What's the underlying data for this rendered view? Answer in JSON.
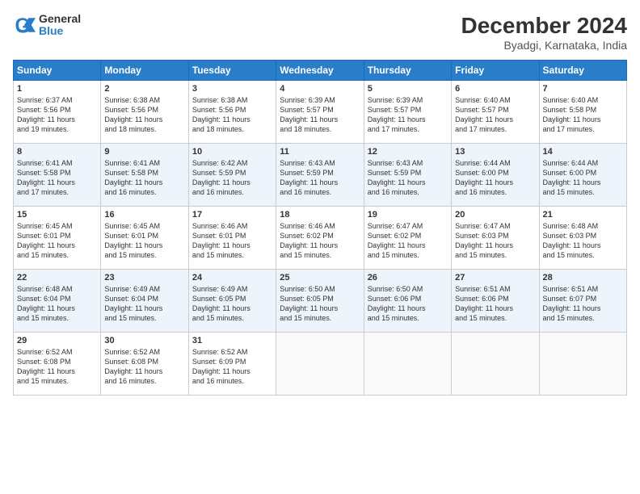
{
  "header": {
    "logo_general": "General",
    "logo_blue": "Blue",
    "month_title": "December 2024",
    "location": "Byadgi, Karnataka, India"
  },
  "days_of_week": [
    "Sunday",
    "Monday",
    "Tuesday",
    "Wednesday",
    "Thursday",
    "Friday",
    "Saturday"
  ],
  "weeks": [
    [
      {
        "day": "1",
        "sunrise": "6:37 AM",
        "sunset": "5:56 PM",
        "daylight": "11 hours and 19 minutes."
      },
      {
        "day": "2",
        "sunrise": "6:38 AM",
        "sunset": "5:56 PM",
        "daylight": "11 hours and 18 minutes."
      },
      {
        "day": "3",
        "sunrise": "6:38 AM",
        "sunset": "5:56 PM",
        "daylight": "11 hours and 18 minutes."
      },
      {
        "day": "4",
        "sunrise": "6:39 AM",
        "sunset": "5:57 PM",
        "daylight": "11 hours and 18 minutes."
      },
      {
        "day": "5",
        "sunrise": "6:39 AM",
        "sunset": "5:57 PM",
        "daylight": "11 hours and 17 minutes."
      },
      {
        "day": "6",
        "sunrise": "6:40 AM",
        "sunset": "5:57 PM",
        "daylight": "11 hours and 17 minutes."
      },
      {
        "day": "7",
        "sunrise": "6:40 AM",
        "sunset": "5:58 PM",
        "daylight": "11 hours and 17 minutes."
      }
    ],
    [
      {
        "day": "8",
        "sunrise": "6:41 AM",
        "sunset": "5:58 PM",
        "daylight": "11 hours and 17 minutes."
      },
      {
        "day": "9",
        "sunrise": "6:41 AM",
        "sunset": "5:58 PM",
        "daylight": "11 hours and 16 minutes."
      },
      {
        "day": "10",
        "sunrise": "6:42 AM",
        "sunset": "5:59 PM",
        "daylight": "11 hours and 16 minutes."
      },
      {
        "day": "11",
        "sunrise": "6:43 AM",
        "sunset": "5:59 PM",
        "daylight": "11 hours and 16 minutes."
      },
      {
        "day": "12",
        "sunrise": "6:43 AM",
        "sunset": "5:59 PM",
        "daylight": "11 hours and 16 minutes."
      },
      {
        "day": "13",
        "sunrise": "6:44 AM",
        "sunset": "6:00 PM",
        "daylight": "11 hours and 16 minutes."
      },
      {
        "day": "14",
        "sunrise": "6:44 AM",
        "sunset": "6:00 PM",
        "daylight": "11 hours and 15 minutes."
      }
    ],
    [
      {
        "day": "15",
        "sunrise": "6:45 AM",
        "sunset": "6:01 PM",
        "daylight": "11 hours and 15 minutes."
      },
      {
        "day": "16",
        "sunrise": "6:45 AM",
        "sunset": "6:01 PM",
        "daylight": "11 hours and 15 minutes."
      },
      {
        "day": "17",
        "sunrise": "6:46 AM",
        "sunset": "6:01 PM",
        "daylight": "11 hours and 15 minutes."
      },
      {
        "day": "18",
        "sunrise": "6:46 AM",
        "sunset": "6:02 PM",
        "daylight": "11 hours and 15 minutes."
      },
      {
        "day": "19",
        "sunrise": "6:47 AM",
        "sunset": "6:02 PM",
        "daylight": "11 hours and 15 minutes."
      },
      {
        "day": "20",
        "sunrise": "6:47 AM",
        "sunset": "6:03 PM",
        "daylight": "11 hours and 15 minutes."
      },
      {
        "day": "21",
        "sunrise": "6:48 AM",
        "sunset": "6:03 PM",
        "daylight": "11 hours and 15 minutes."
      }
    ],
    [
      {
        "day": "22",
        "sunrise": "6:48 AM",
        "sunset": "6:04 PM",
        "daylight": "11 hours and 15 minutes."
      },
      {
        "day": "23",
        "sunrise": "6:49 AM",
        "sunset": "6:04 PM",
        "daylight": "11 hours and 15 minutes."
      },
      {
        "day": "24",
        "sunrise": "6:49 AM",
        "sunset": "6:05 PM",
        "daylight": "11 hours and 15 minutes."
      },
      {
        "day": "25",
        "sunrise": "6:50 AM",
        "sunset": "6:05 PM",
        "daylight": "11 hours and 15 minutes."
      },
      {
        "day": "26",
        "sunrise": "6:50 AM",
        "sunset": "6:06 PM",
        "daylight": "11 hours and 15 minutes."
      },
      {
        "day": "27",
        "sunrise": "6:51 AM",
        "sunset": "6:06 PM",
        "daylight": "11 hours and 15 minutes."
      },
      {
        "day": "28",
        "sunrise": "6:51 AM",
        "sunset": "6:07 PM",
        "daylight": "11 hours and 15 minutes."
      }
    ],
    [
      {
        "day": "29",
        "sunrise": "6:52 AM",
        "sunset": "6:08 PM",
        "daylight": "11 hours and 15 minutes."
      },
      {
        "day": "30",
        "sunrise": "6:52 AM",
        "sunset": "6:08 PM",
        "daylight": "11 hours and 16 minutes."
      },
      {
        "day": "31",
        "sunrise": "6:52 AM",
        "sunset": "6:09 PM",
        "daylight": "11 hours and 16 minutes."
      },
      null,
      null,
      null,
      null
    ]
  ]
}
